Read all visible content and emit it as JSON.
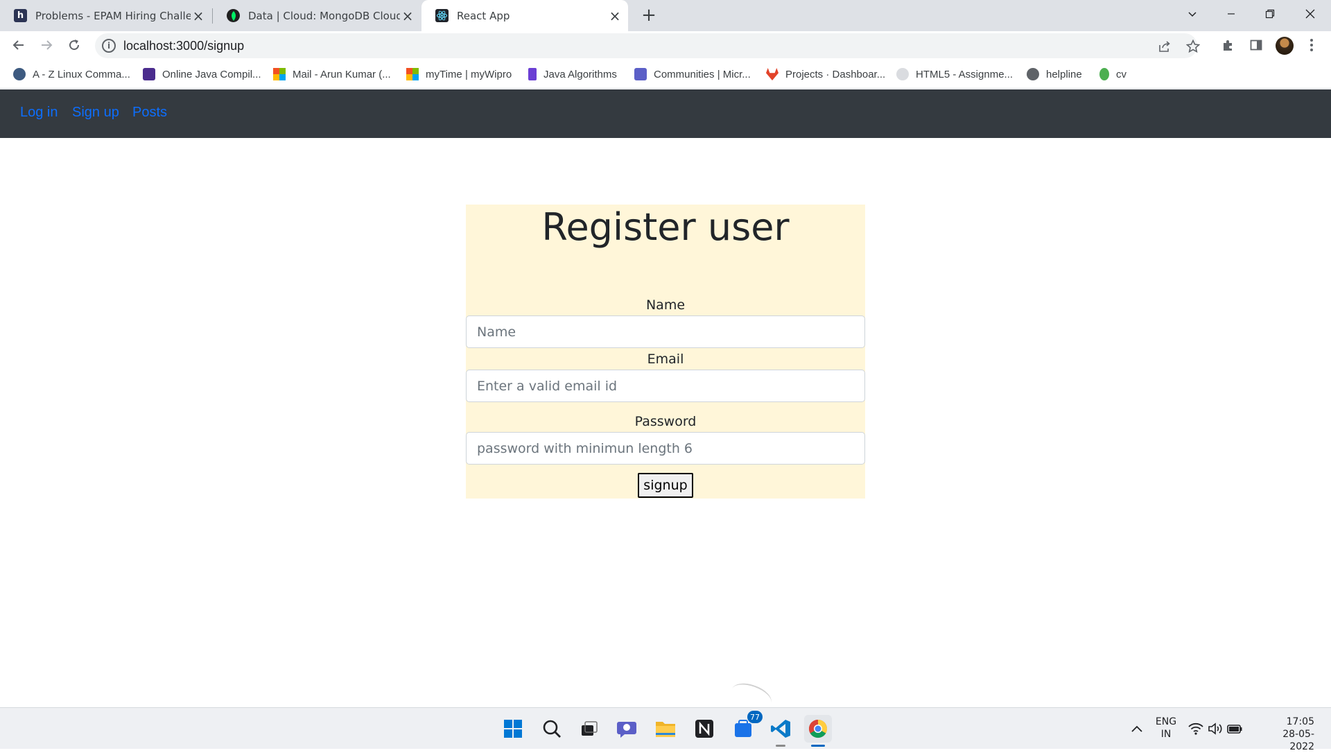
{
  "browser": {
    "tabs": [
      {
        "title": "Problems - EPAM Hiring Challenge",
        "icon": "hackerearth-icon",
        "color": "#2c3454"
      },
      {
        "title": "Data | Cloud: MongoDB Cloud",
        "icon": "mongodb-icon",
        "color": "#00684a"
      },
      {
        "title": "React App",
        "icon": "react-icon",
        "color": "#20232a"
      }
    ],
    "active_tab": 2,
    "url": "localhost:3000/signup",
    "bookmarks": [
      {
        "label": "A - Z Linux Comma...",
        "color": "#3d5a80"
      },
      {
        "label": "Online Java Compil...",
        "color": "#4b2c8e"
      },
      {
        "label": "Mail - Arun Kumar (...",
        "color": "#f25022"
      },
      {
        "label": "myTime | myWipro",
        "color": "#7fba00"
      },
      {
        "label": "Java Algorithms",
        "color": "#6b3fd4"
      },
      {
        "label": "Communities | Micr...",
        "color": "#5b5fc7"
      },
      {
        "label": "Projects · Dashboar...",
        "color": "#e24329"
      },
      {
        "label": "HTML5 - Assignme...",
        "color": "#9aa0a6"
      },
      {
        "label": "helpline",
        "color": "#5f6368"
      },
      {
        "label": "cv",
        "color": "#4caf50"
      }
    ]
  },
  "app": {
    "nav": {
      "login": "Log in",
      "signup": "Sign up",
      "posts": "Posts"
    },
    "form": {
      "title": "Register user",
      "name_label": "Name",
      "name_placeholder": "Name",
      "email_label": "Email",
      "email_placeholder": "Enter a valid email id",
      "password_label": "Password",
      "password_placeholder": "password with minimun length 6",
      "submit_label": "signup"
    }
  },
  "taskbar": {
    "badge_count": "77",
    "lang": "ENG",
    "region": "IN",
    "time": "17:05",
    "date": "28-05-2022"
  }
}
